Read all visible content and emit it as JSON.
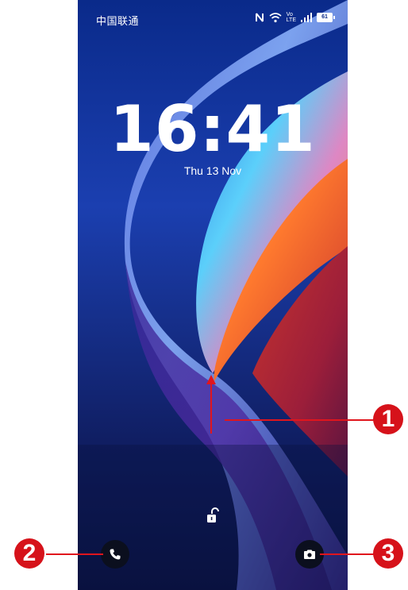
{
  "statusbar": {
    "carrier": "中国联通",
    "volte": "Vo",
    "network": "LTE",
    "battery": "61",
    "icons": [
      "nfc-icon",
      "wifi-icon",
      "volte-lte-icon",
      "signal-icon",
      "battery-icon"
    ]
  },
  "lockscreen": {
    "time": "16:41",
    "date": "Thu 13 Nov",
    "unlock_icon": "unlock-icon",
    "shortcuts": [
      {
        "name": "phone",
        "icon": "phone-icon"
      },
      {
        "name": "camera",
        "icon": "camera-icon"
      }
    ]
  },
  "annotations": {
    "callout_1": "1",
    "callout_2": "2",
    "callout_3": "3",
    "color": "#d6121a"
  }
}
